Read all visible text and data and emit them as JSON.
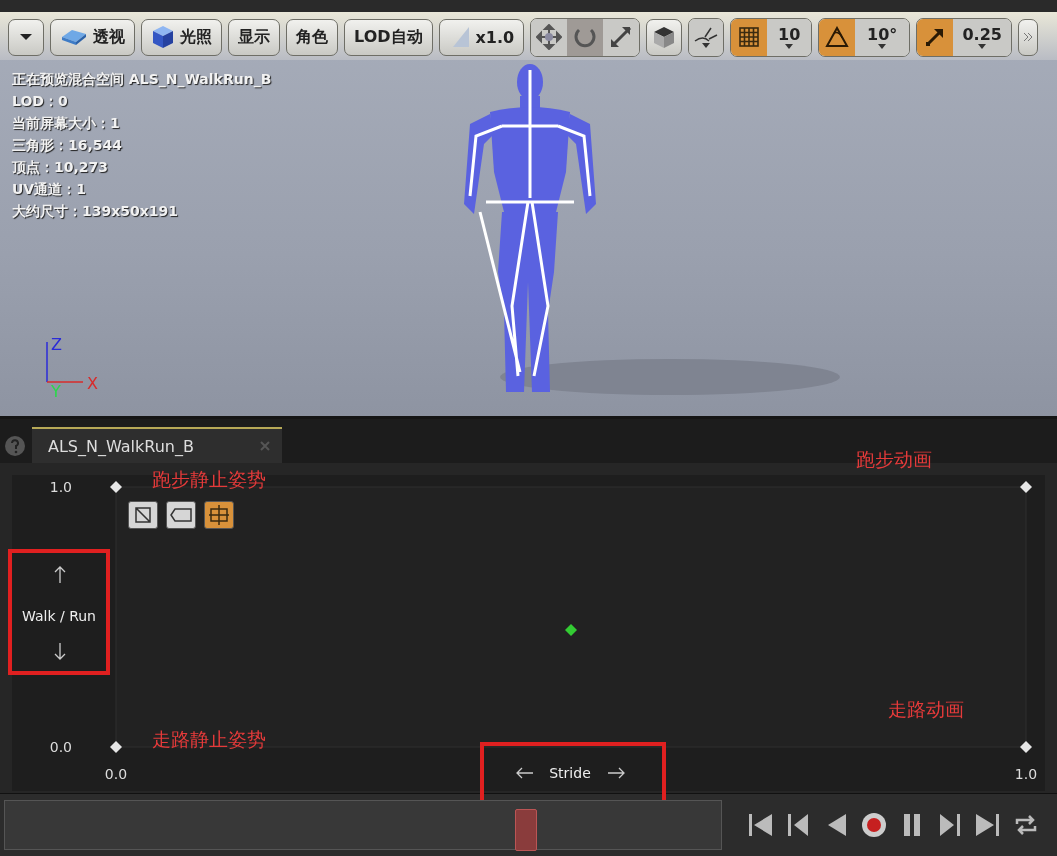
{
  "toolbar": [
    {
      "kind": "menu"
    },
    {
      "kind": "perspective",
      "label": "透视"
    },
    {
      "kind": "lighting",
      "label": "光照"
    },
    {
      "kind": "text",
      "label": "显示"
    },
    {
      "kind": "text",
      "label": "角色"
    },
    {
      "kind": "text",
      "label": "LOD自动"
    },
    {
      "kind": "speed",
      "label": "x1.0"
    }
  ],
  "transform_tools": [
    {
      "kind": "move",
      "selected": false
    },
    {
      "kind": "rotate",
      "selected": true
    },
    {
      "kind": "scale",
      "selected": false
    }
  ],
  "snaps": [
    {
      "kind": "grid",
      "value": "10",
      "on": true
    },
    {
      "kind": "angle",
      "value": "10°",
      "on": true
    },
    {
      "kind": "scale",
      "value": "0.25",
      "on": true
    }
  ],
  "viewport_info": [
    "正在预览混合空间 ALS_N_WalkRun_B",
    "LOD：0",
    "当前屏幕大小：1",
    "三角形：16,544",
    "顶点：10,273",
    "UV通道：1",
    "大约尺寸：139x50x191"
  ],
  "axis_gizmo": [
    "Z",
    "Y",
    "X"
  ],
  "axis_label_frames": {
    "y": true,
    "x": true
  },
  "tab": {
    "label": "ALS_N_WalkRun_B",
    "selected": true
  },
  "graph_tools": [
    {
      "selected": false
    },
    {
      "selected": false
    },
    {
      "selected": true
    }
  ],
  "chart_data": {
    "type": "scatter",
    "xlabel": "Stride",
    "ylabel": "Walk / Run",
    "xlim": [
      0,
      1
    ],
    "ylim": [
      0,
      1
    ],
    "xticks": [
      {
        "value": 0,
        "label": "0.0"
      },
      {
        "value": 1,
        "label": "1.0"
      }
    ],
    "yticks": [
      {
        "value": 0,
        "label": "0.0"
      },
      {
        "value": 1,
        "label": "1.0"
      }
    ],
    "series": [
      {
        "color": "#e6e6e6",
        "x": [
          0,
          1,
          0,
          1
        ],
        "values": [
          0,
          0,
          1,
          1
        ]
      },
      {
        "color": "#33cc33",
        "x": [
          0.5
        ],
        "values": [
          0.45
        ]
      }
    ],
    "annotations": [
      "跑步静止姿势",
      "跑步动画",
      "走路动画",
      "走路静止姿势"
    ]
  }
}
